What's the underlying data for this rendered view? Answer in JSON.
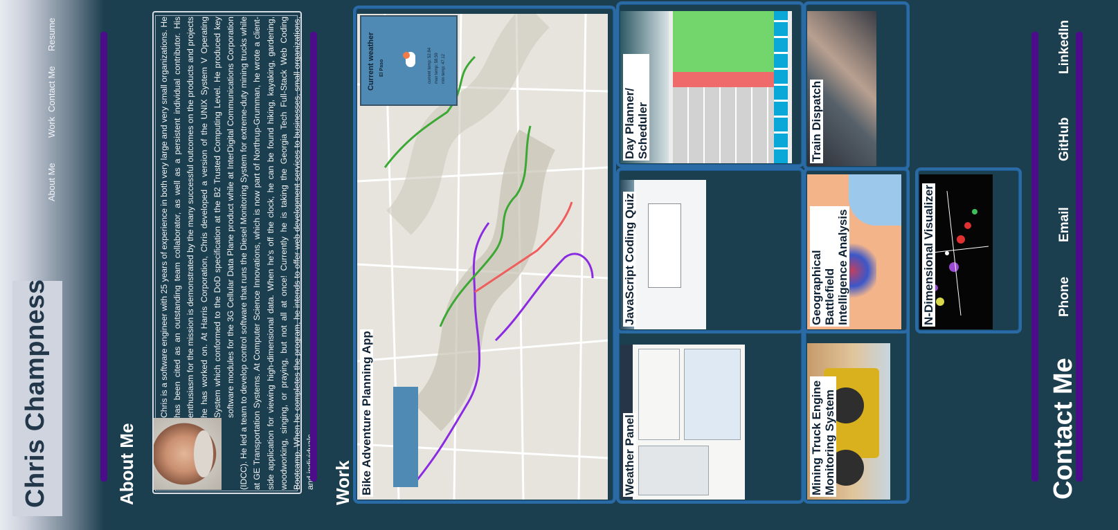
{
  "header": {
    "name": "Chris Champness",
    "nav": [
      "About Me",
      "Work",
      "Contact Me",
      "Resume"
    ]
  },
  "about": {
    "title": "About Me",
    "paragraph": "Chris is a software engineer with 25 years of experience in both very large and very small organizations. He has been cited as an outstanding team collaborator, as well as a persistent individual contributor. His enthusiasm for the mission is demonstrated by the many successful outcomes on the products and projects he has worked on. At Harris Corporation, Chris developed a version of the UNIX System V Operating System which conformed to the DoD specification at the B2 Trusted Computing Level. He produced key software modules for the 3G Cellular Data Plane product while at InterDigital Communications Corporation (IDCC). He led a team to develop control software that runs the Diesel Monitoring System for extreme-duty mining trucks while at GE Transportation Systems. At Computer Science Innovations, which is now part of Northrup-Grumman, he wrote a client-side application for viewing high-dimensional data. When he's off the clock, he can be found hiking, kayaking, gardening, woodworking, singing, or praying, but not all at once! Currently he is taking the Georgia Tech Full-Stack Web Coding Bootcamp. When he completes the program, he intends to offer web development services to businesses, small organizations, and individuals."
  },
  "work": {
    "title": "Work",
    "projects": [
      {
        "title": "Bike Adventure Planning App"
      },
      {
        "title": "Weather Panel"
      },
      {
        "title": "JavaScript Coding Quiz"
      },
      {
        "title": "Day Planner/ Scheduler"
      },
      {
        "title": "Mining Truck Engine Monitoring System"
      },
      {
        "title": "Geographical Battlefield Intelligence Analysis"
      },
      {
        "title": "Train Dispatch"
      },
      {
        "title": "N-Dimensional Visualizer"
      }
    ],
    "weather_widget": {
      "title": "Current weather",
      "city": "El Paso",
      "lines": [
        "current temp: 52.84",
        "max temp: 58.59",
        "min temp: 47.12"
      ]
    }
  },
  "contact": {
    "title": "Contact Me",
    "items": [
      "Phone",
      "Email",
      "GitHub",
      "LinkedIn"
    ]
  },
  "colors": {
    "background": "#1c3f4f",
    "accent_bar": "#4b0d8a",
    "card_border": "#2a6ba6",
    "route_purple": "#8a2be2",
    "route_green": "#3aa832",
    "route_red": "#ef5d5d"
  }
}
